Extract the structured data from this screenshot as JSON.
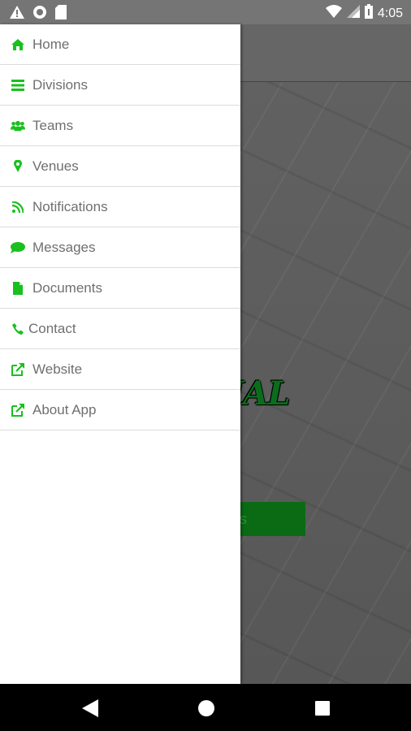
{
  "status_bar": {
    "time": "4:05",
    "left_icons": [
      "warning-icon",
      "circle-icon",
      "sd-card-icon"
    ],
    "right_icons": [
      "wifi-icon",
      "cell-signal-icon",
      "battery-icon"
    ]
  },
  "background": {
    "hero_title_fragment": "ONAL",
    "hero_button_fragment": "s"
  },
  "drawer": {
    "accent_color": "#19c01e",
    "items": [
      {
        "label": "Home",
        "icon": "home-icon"
      },
      {
        "label": "Divisions",
        "icon": "list-icon"
      },
      {
        "label": "Teams",
        "icon": "users-icon"
      },
      {
        "label": "Venues",
        "icon": "map-marker-icon"
      },
      {
        "label": "Notifications",
        "icon": "rss-icon"
      },
      {
        "label": "Messages",
        "icon": "comment-icon"
      },
      {
        "label": "Documents",
        "icon": "file-icon"
      },
      {
        "label": "Contact",
        "icon": "phone-icon"
      },
      {
        "label": "Website",
        "icon": "external-link-icon"
      },
      {
        "label": "About App",
        "icon": "external-link-icon"
      }
    ]
  },
  "nav_bar": {
    "buttons": [
      "back-icon",
      "home-circle-icon",
      "recents-icon"
    ]
  }
}
